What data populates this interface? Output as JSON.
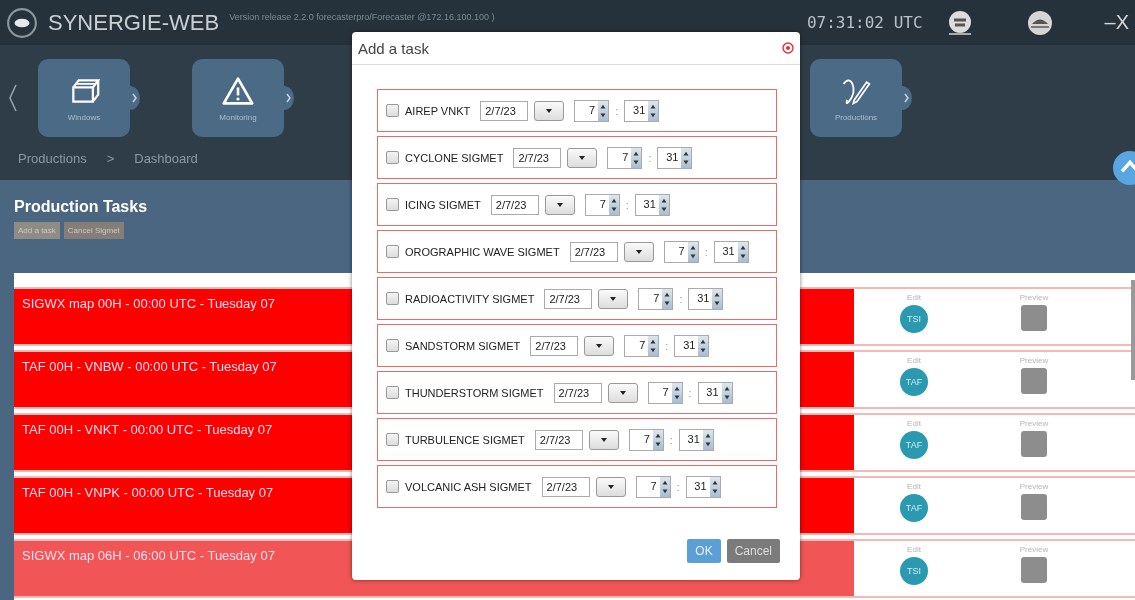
{
  "header": {
    "title": "SYNERGIE-WEB",
    "version": "Version release 2.2.0 forecasterpro/Forecaster @172.16.100.100 )",
    "time": "07:31:02 UTC",
    "window_controls": "–X"
  },
  "nav_tiles": [
    {
      "label": "Windows",
      "kind": "windows"
    },
    {
      "label": "Monitoring",
      "kind": "warning"
    },
    {
      "label": "Productions",
      "kind": "pen"
    }
  ],
  "breadcrumb": [
    "Productions",
    ">",
    "Dashboard"
  ],
  "section": {
    "title": "Production Tasks",
    "buttons": [
      "Add a task",
      "Cancel Sigmet"
    ]
  },
  "tasks": [
    {
      "title": "SIGWX map 00H  - 00:00 UTC - Tuesday 07",
      "dimmed": false,
      "edit_label": "Edit",
      "badge": "TSI",
      "preview_label": "Preview"
    },
    {
      "title": "TAF 00H - VNBW - 00:00 UTC - Tuesday 07",
      "dimmed": false,
      "edit_label": "Edit",
      "badge": "TAF",
      "preview_label": "Preview"
    },
    {
      "title": "TAF 00H - VNKT - 00:00 UTC - Tuesday 07",
      "dimmed": false,
      "edit_label": "Edit",
      "badge": "TAF",
      "preview_label": "Preview"
    },
    {
      "title": "TAF 00H - VNPK - 00:00 UTC - Tuesday 07",
      "dimmed": false,
      "edit_label": "Edit",
      "badge": "TAF",
      "preview_label": "Preview"
    },
    {
      "title": "SIGWX map 06H - 06:00 UTC - Tuesday 07",
      "dimmed": true,
      "edit_label": "Edit",
      "badge": "TSI",
      "preview_label": "Preview"
    }
  ],
  "dialog": {
    "title": "Add a task",
    "items": [
      {
        "label": "AIREP VNKT",
        "checked": false,
        "date": "2/7/23",
        "hour": "7",
        "minute": "31"
      },
      {
        "label": "CYCLONE SIGMET",
        "checked": false,
        "date": "2/7/23",
        "hour": "7",
        "minute": "31"
      },
      {
        "label": "ICING SIGMET",
        "checked": false,
        "date": "2/7/23",
        "hour": "7",
        "minute": "31"
      },
      {
        "label": "OROGRAPHIC WAVE SIGMET",
        "checked": false,
        "date": "2/7/23",
        "hour": "7",
        "minute": "31"
      },
      {
        "label": "RADIOACTIVITY SIGMET",
        "checked": false,
        "date": "2/7/23",
        "hour": "7",
        "minute": "31"
      },
      {
        "label": "SANDSTORM SIGMET",
        "checked": false,
        "date": "2/7/23",
        "hour": "7",
        "minute": "31"
      },
      {
        "label": "THUNDERSTORM SIGMET",
        "checked": false,
        "date": "2/7/23",
        "hour": "7",
        "minute": "31"
      },
      {
        "label": "TURBULENCE SIGMET",
        "checked": false,
        "date": "2/7/23",
        "hour": "7",
        "minute": "31"
      },
      {
        "label": "VOLCANIC ASH SIGMET",
        "checked": false,
        "date": "2/7/23",
        "hour": "7",
        "minute": "31"
      }
    ],
    "separator": ":",
    "ok": "OK",
    "cancel": "Cancel"
  }
}
